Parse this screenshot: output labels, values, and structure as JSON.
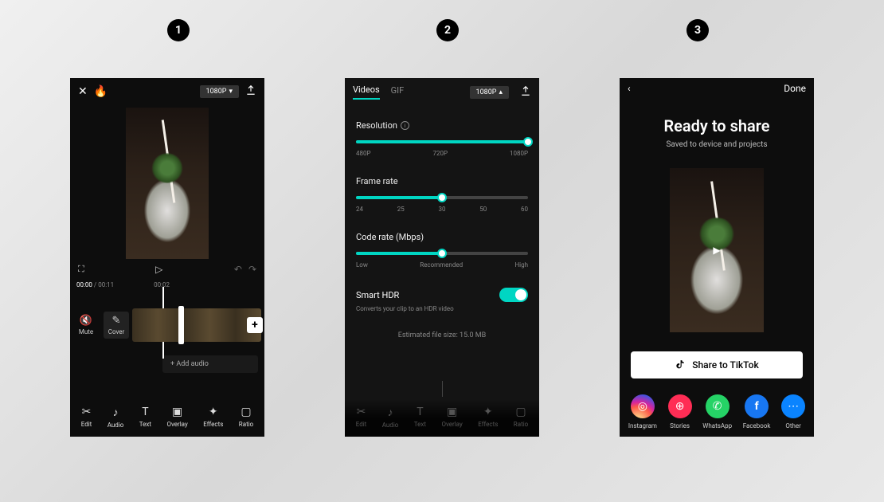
{
  "steps": {
    "one": "1",
    "two": "2",
    "three": "3"
  },
  "screen1": {
    "resolution_pill": "1080P",
    "current_time": "00:00",
    "total_time": "00:11",
    "tick_00_02": "00:02",
    "mute_label": "Mute",
    "cover_label": "Cover",
    "add_audio": "+ Add audio",
    "bottom": {
      "edit": "Edit",
      "audio": "Audio",
      "text": "Text",
      "overlay": "Overlay",
      "effects": "Effects",
      "ratio": "Ratio"
    }
  },
  "screen2": {
    "tab_videos": "Videos",
    "tab_gif": "GIF",
    "resolution_pill": "1080P",
    "resolution": {
      "label": "Resolution",
      "t480": "480P",
      "t720": "720P",
      "t1080": "1080P",
      "value_pct": 100
    },
    "frame_rate": {
      "label": "Frame rate",
      "t24": "24",
      "t25": "25",
      "t30": "30",
      "t50": "50",
      "t60": "60",
      "value_pct": 50
    },
    "code_rate": {
      "label": "Code rate (Mbps)",
      "low": "Low",
      "rec": "Recommended",
      "high": "High",
      "value_pct": 50
    },
    "hdr": {
      "label": "Smart HDR",
      "desc": "Converts your clip to an HDR video"
    },
    "estimate": "Estimated file size: 15.0 MB",
    "bottom": {
      "edit": "Edit",
      "audio": "Audio",
      "text": "Text",
      "overlay": "Overlay",
      "effects": "Effects",
      "ratio": "Ratio"
    }
  },
  "screen3": {
    "done": "Done",
    "title": "Ready to share",
    "subtitle": "Saved to device and projects",
    "share_tiktok": "Share to TikTok",
    "share": {
      "instagram": "Instagram",
      "stories": "Stories",
      "whatsapp": "WhatsApp",
      "facebook": "Facebook",
      "other": "Other"
    }
  }
}
